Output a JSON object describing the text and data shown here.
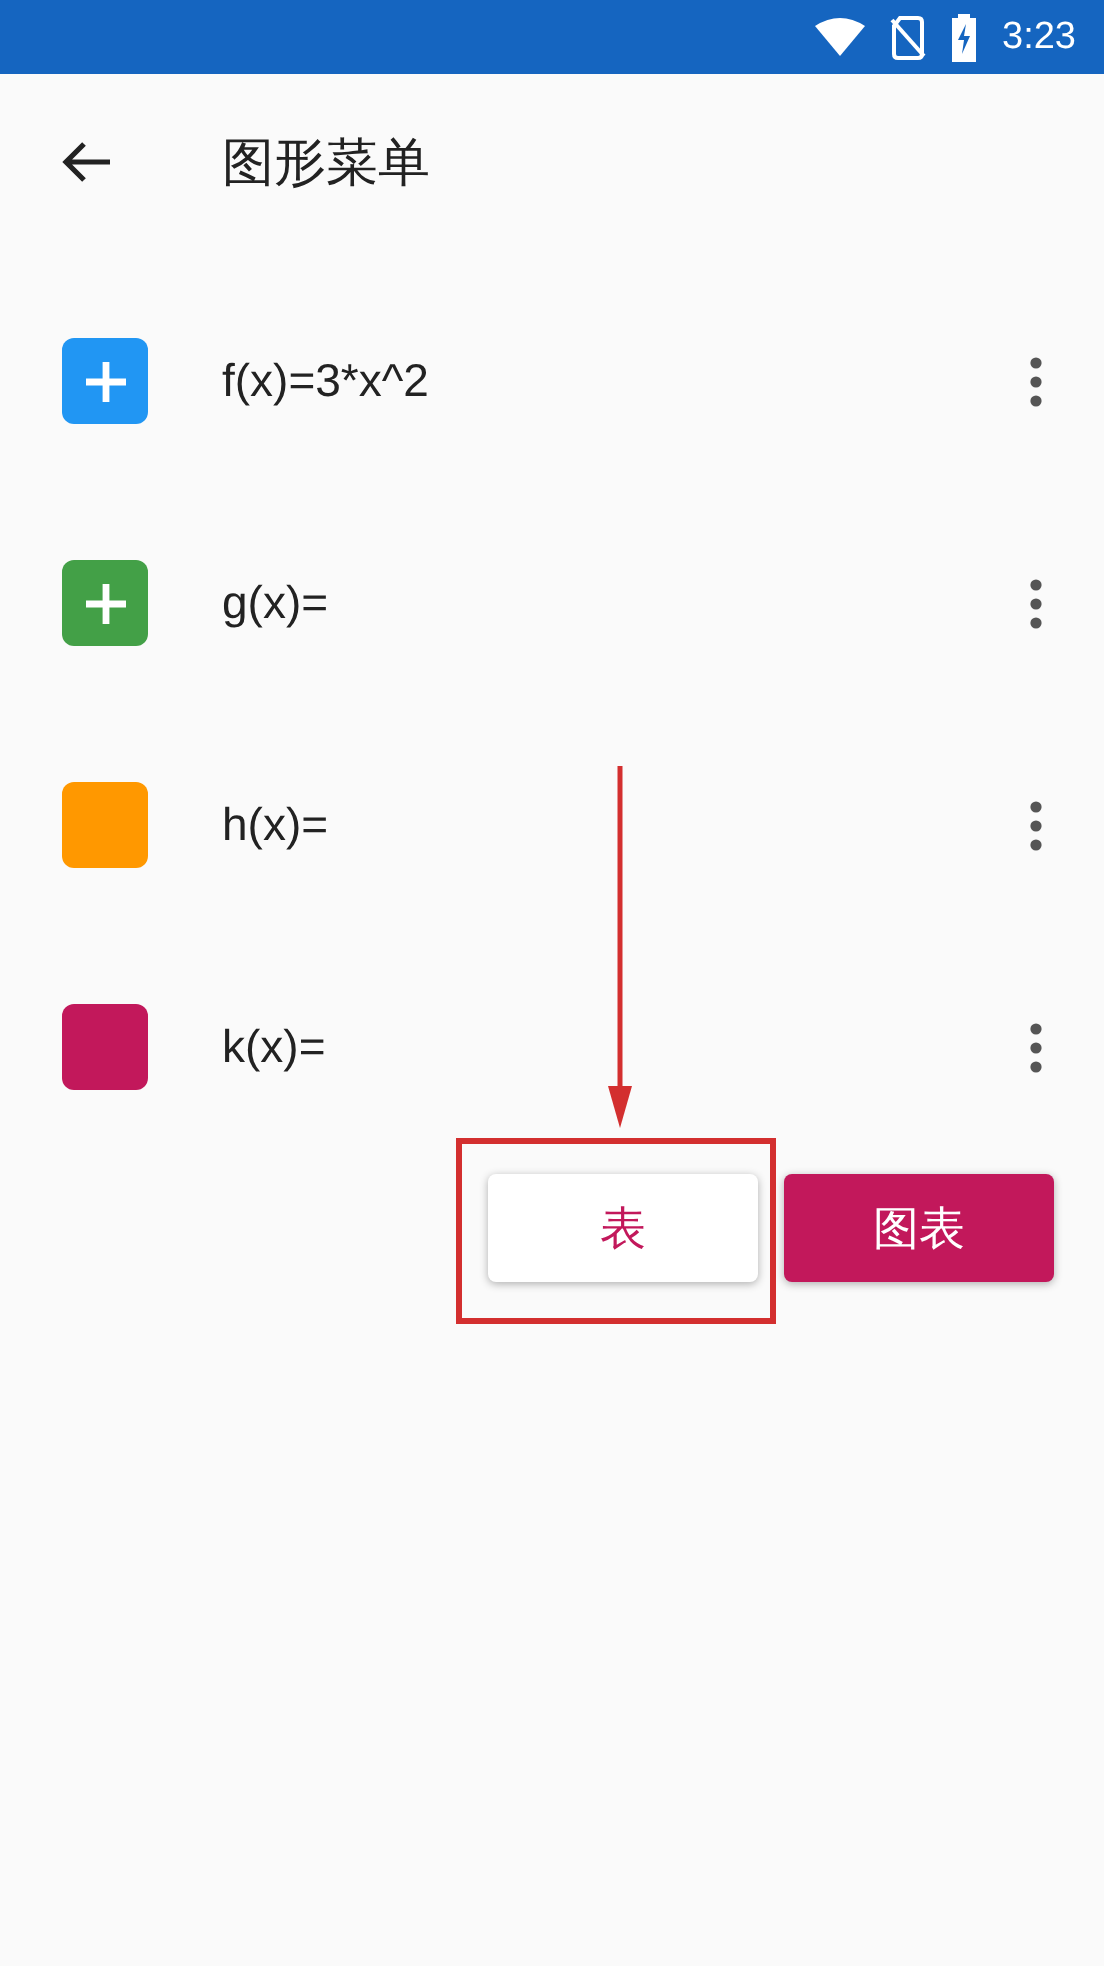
{
  "status_bar": {
    "time": "3:23"
  },
  "toolbar": {
    "title": "图形菜单"
  },
  "functions": [
    {
      "expression": "f(x)=3*x^2",
      "kind": "plus",
      "color": "#2196f3"
    },
    {
      "expression": "g(x)=",
      "kind": "plus",
      "color": "#43a047"
    },
    {
      "expression": "h(x)=",
      "kind": "empty",
      "color": "#ff9800"
    },
    {
      "expression": "k(x)=",
      "kind": "empty",
      "color": "#c2185b"
    }
  ],
  "buttons": [
    {
      "label": "表",
      "kind": "flat",
      "highlighted": true
    },
    {
      "label": "图表",
      "kind": "filled",
      "highlighted": false
    }
  ]
}
